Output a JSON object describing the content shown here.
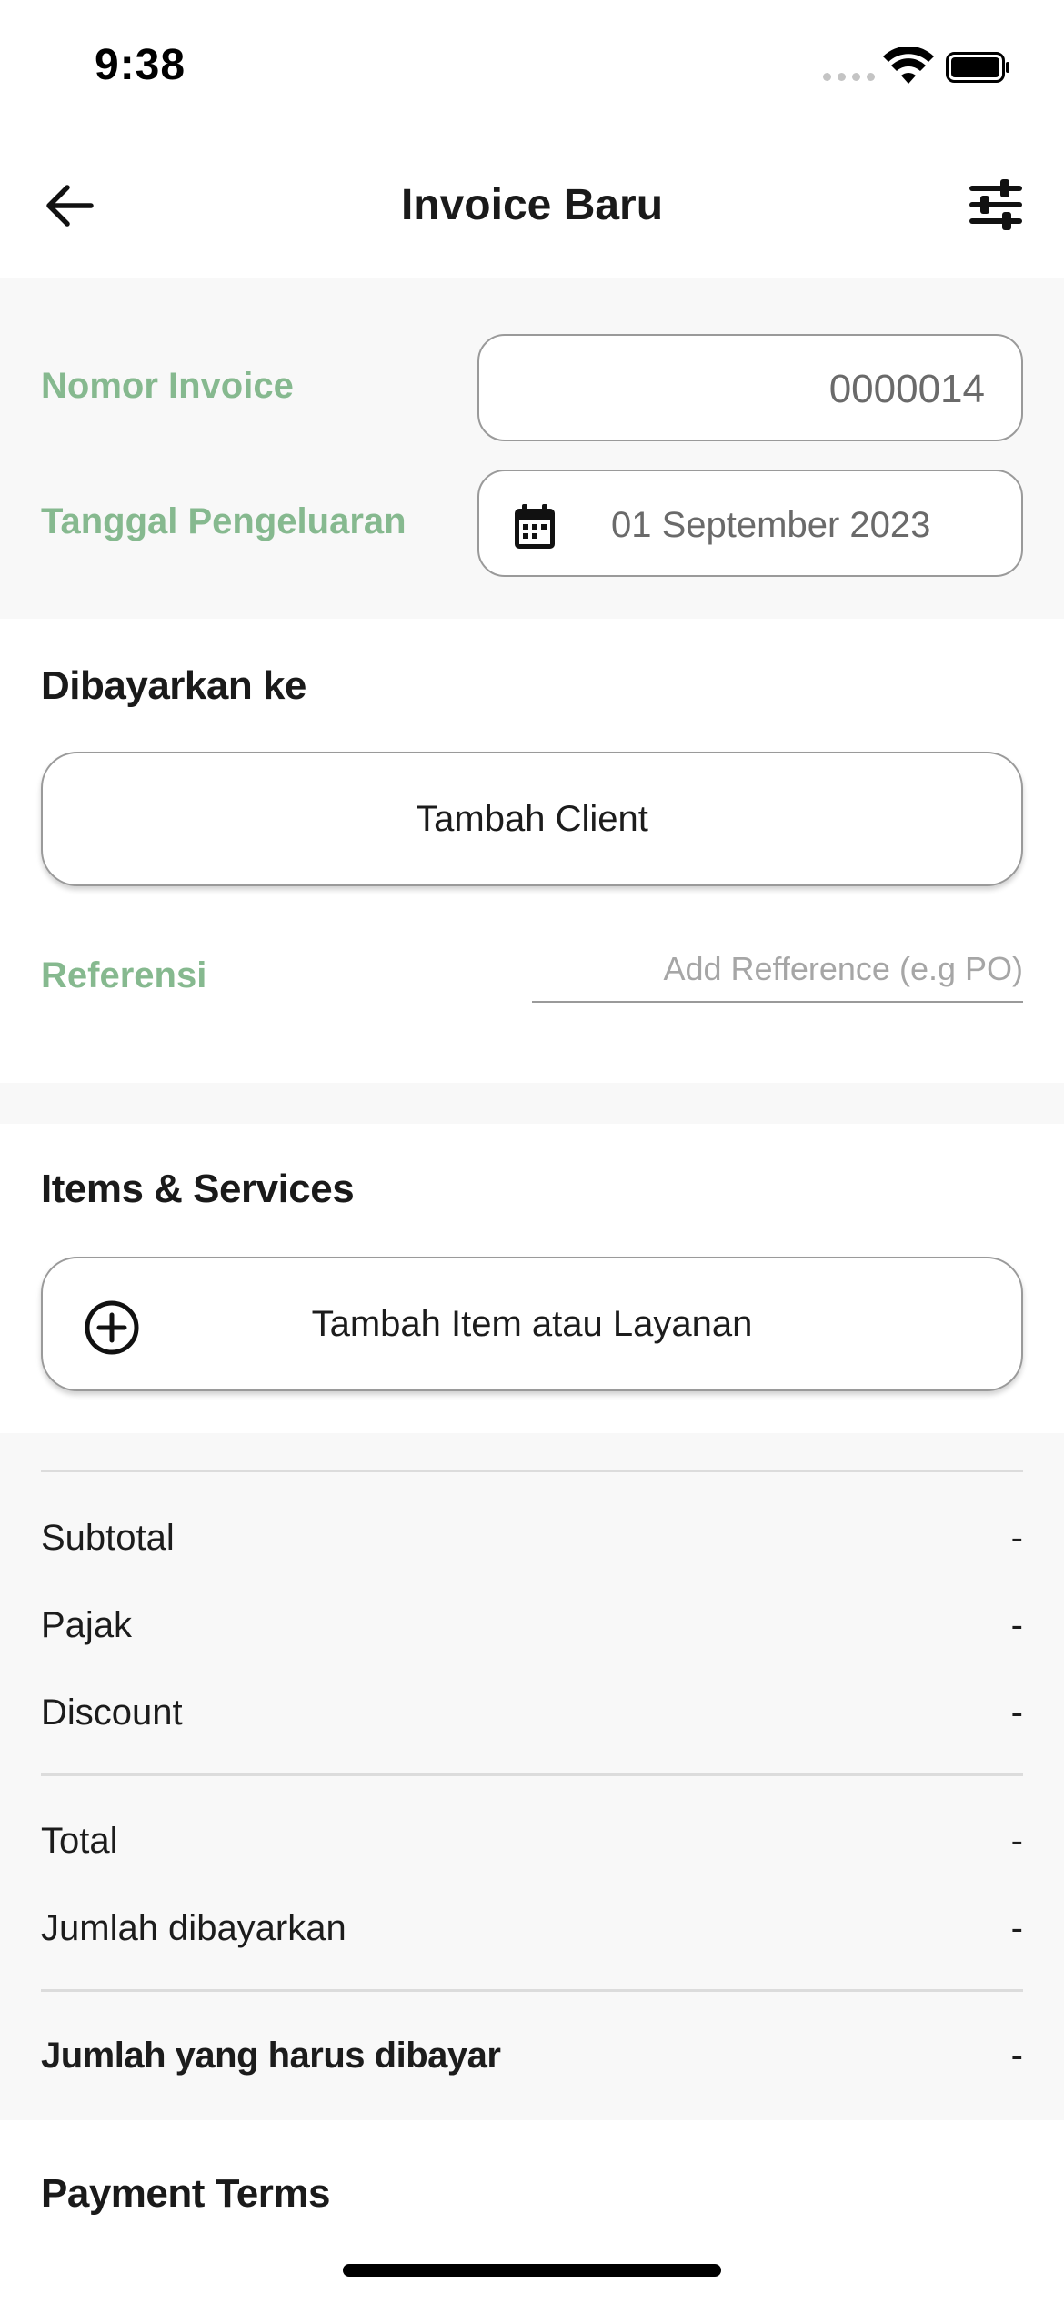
{
  "status_bar": {
    "time": "9:38"
  },
  "header": {
    "title": "Invoice Baru"
  },
  "invoice": {
    "number_label": "Nomor Invoice",
    "number_value": "0000014",
    "date_label": "Tanggal Pengeluaran",
    "date_value": "01 September 2023"
  },
  "paid_to": {
    "title": "Dibayarkan ke",
    "add_client_label": "Tambah Client",
    "reference_label": "Referensi",
    "reference_placeholder": "Add Refference (e.g PO)"
  },
  "items": {
    "title": "Items & Services",
    "add_item_label": "Tambah Item atau Layanan"
  },
  "totals": {
    "subtotal_label": "Subtotal",
    "subtotal_value": "-",
    "tax_label": "Pajak",
    "tax_value": "-",
    "discount_label": "Discount",
    "discount_value": "-",
    "total_label": "Total",
    "total_value": "-",
    "paid_label": "Jumlah dibayarkan",
    "paid_value": "-",
    "due_label": "Jumlah yang harus dibayar",
    "due_value": "-"
  },
  "payment_terms": {
    "title": "Payment Terms"
  },
  "colors": {
    "label_green": "#86b98f",
    "section_bg": "#f8f8f8",
    "border_gray": "#9a9a9a"
  },
  "icons": {
    "back": "arrow-left-icon",
    "filter": "sliders-icon",
    "calendar": "calendar-icon",
    "add": "plus-circle-icon"
  }
}
